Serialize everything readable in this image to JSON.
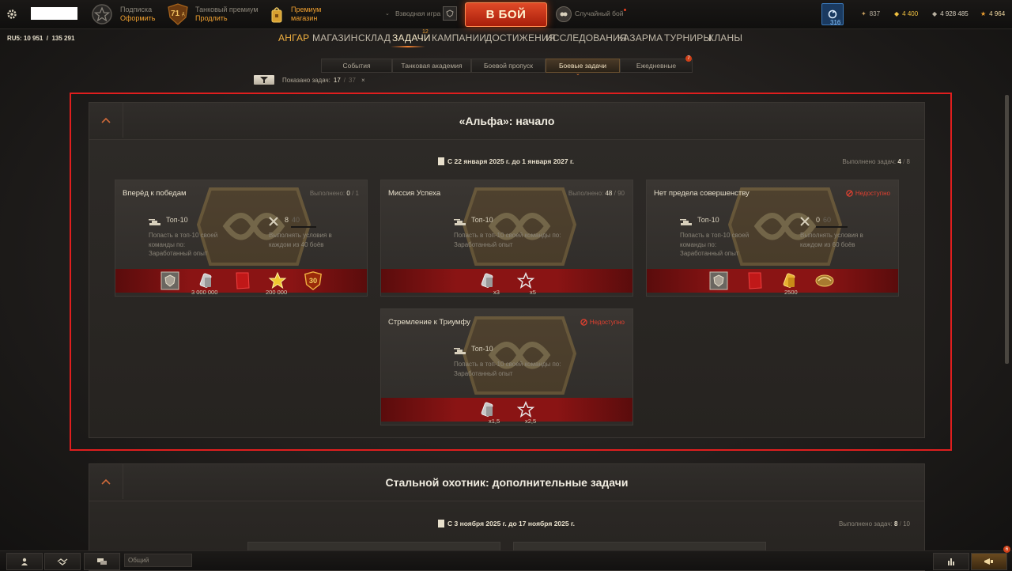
{
  "header": {
    "subscription": {
      "line1": "Подписка",
      "line2": "Оформить"
    },
    "premium": {
      "level": "71",
      "level_suffix": "д",
      "line1": "Танковый премиум",
      "line2": "Продлить"
    },
    "shop": {
      "line1": "Премиум",
      "line2": "магазин"
    },
    "platoon_label": "Взводная игра",
    "battle_button": "В БОЙ",
    "battle_type": "Случайный бой",
    "notifications_count": "316",
    "currencies": {
      "bonds": "837",
      "gold": "4 400",
      "credits": "4 928 485",
      "free_xp": "4 964"
    }
  },
  "server_info": "RU5: 10 951  /  135 291",
  "nav": {
    "items": [
      "АНГАР",
      "МАГАЗИН",
      "СКЛАД",
      "ЗАДАЧИ",
      "КАМПАНИИ",
      "ДОСТИЖЕНИЯ",
      "ИССЛЕДОВАНИЯ",
      "КАЗАРМА",
      "ТУРНИРЫ",
      "КЛАНЫ"
    ],
    "tasks_badge": "12"
  },
  "subtabs": {
    "items": [
      "События",
      "Танковая академия",
      "Боевой пропуск",
      "Боевые задачи",
      "Ежедневные"
    ],
    "daily_badge": "7"
  },
  "filter": {
    "label": "Показано задач:",
    "shown": "17",
    "total": "37",
    "clear": "×"
  },
  "section1": {
    "title": "«Альфа»: начало",
    "dates": "С 22 января 2025 г. до 1 января 2027 г.",
    "done_label": "Выполнено задач:",
    "done": "4",
    "done_total": "8",
    "cards": [
      {
        "title": "Вперёд к победам",
        "status_label": "Выполнено:",
        "status_done": "0",
        "status_total": "1",
        "cond1_title": "Топ-10",
        "cond1_desc": [
          "Попасть в топ-10 своей",
          "команды по:",
          "Заработанный опыт"
        ],
        "cond2_value": "8",
        "cond2_total": "40",
        "cond2_desc": [
          "Выполнять условия в",
          "каждом из 40 боёв"
        ],
        "reward_values": [
          "3 000 000",
          "200 000"
        ]
      },
      {
        "title": "Миссия Успеха",
        "status_label": "Выполнено:",
        "status_done": "48",
        "status_total": "90",
        "cond1_title": "Топ-10",
        "cond1_desc": [
          "Попасть в топ-10 своей команды по:",
          "Заработанный опыт"
        ],
        "reward_values": [
          "x3",
          "x5"
        ]
      },
      {
        "title": "Нет предела совершенству",
        "unavailable": "Недоступно",
        "cond1_title": "Топ-10",
        "cond1_desc": [
          "Попасть в топ-10 своей",
          "команды по:",
          "Заработанный опыт"
        ],
        "cond2_value": "0",
        "cond2_total": "60",
        "cond2_desc": [
          "Выполнять условия в",
          "каждом из 60 боёв"
        ],
        "reward_values": [
          "2500"
        ]
      },
      {
        "title": "Стремление к Триумфу",
        "unavailable": "Недоступно",
        "cond1_title": "Топ-10",
        "cond1_desc": [
          "Попасть в топ-10 своей команды по:",
          "Заработанный опыт"
        ],
        "reward_values": [
          "x1,5",
          "x2,5"
        ]
      }
    ]
  },
  "section2": {
    "title": "Стальной охотник: дополнительные задачи",
    "dates": "С 3 ноября 2025 г. до 17 ноября 2025 г.",
    "done_label": "Выполнено задач:",
    "done": "8",
    "done_total": "10"
  },
  "chat": {
    "placeholder": "Общий",
    "badge": "6"
  },
  "colors": {
    "accent": "#f0a030",
    "battle": "#c8280f",
    "unavailable": "#e04030",
    "reward_bar": "#8a1414",
    "highlight_border": "#e01e1e"
  }
}
